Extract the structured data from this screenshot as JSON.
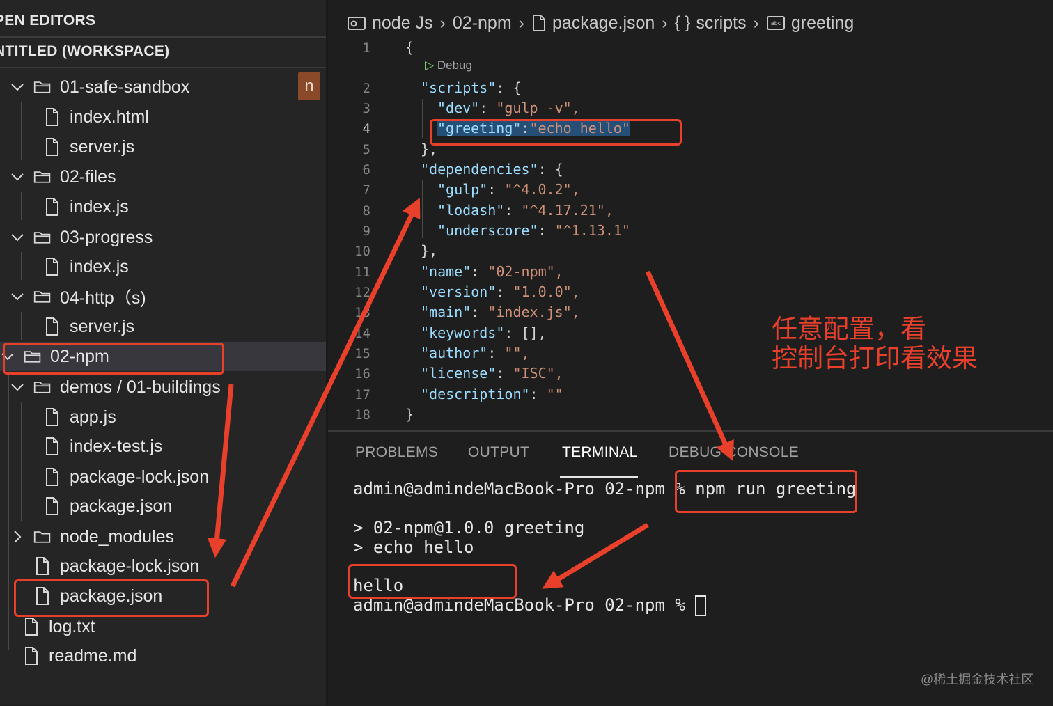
{
  "sidebar": {
    "open_editors": "PEN EDITORS",
    "workspace": "NTITLED (WORKSPACE)",
    "badge": "n",
    "items": [
      {
        "label": "01-safe-sandbox",
        "type": "folder-open"
      },
      {
        "label": "index.html",
        "type": "file"
      },
      {
        "label": "server.js",
        "type": "file"
      },
      {
        "label": "02-files",
        "type": "folder-open"
      },
      {
        "label": "index.js",
        "type": "file"
      },
      {
        "label": "03-progress",
        "type": "folder-open"
      },
      {
        "label": "index.js",
        "type": "file"
      },
      {
        "label": "04-http（s)",
        "type": "folder-open"
      },
      {
        "label": "server.js",
        "type": "file"
      },
      {
        "label": "02-npm",
        "type": "folder-open"
      },
      {
        "label": "demos / 01-buildings",
        "type": "folder-open"
      },
      {
        "label": "app.js",
        "type": "file"
      },
      {
        "label": "index-test.js",
        "type": "file"
      },
      {
        "label": "package-lock.json",
        "type": "file"
      },
      {
        "label": "package.json",
        "type": "file"
      },
      {
        "label": "node_modules",
        "type": "folder-closed"
      },
      {
        "label": "package-lock.json",
        "type": "file"
      },
      {
        "label": "package.json",
        "type": "file"
      },
      {
        "label": "log.txt",
        "type": "file"
      },
      {
        "label": "readme.md",
        "type": "file"
      }
    ]
  },
  "breadcrumb": {
    "items": [
      "node Js",
      "02-npm",
      "package.json",
      "scripts",
      "greeting"
    ]
  },
  "editor": {
    "codelens": "Debug",
    "line_numbers": [
      "1",
      "2",
      "3",
      "4",
      "5",
      "6",
      "7",
      "8",
      "9",
      "10",
      "11",
      "12",
      "13",
      "14",
      "15",
      "16",
      "17",
      "18"
    ],
    "lines": [
      {
        "key": "",
        "value": "{"
      },
      {
        "key": "\"scripts\"",
        "value": ": {"
      },
      {
        "key": "\"dev\"",
        "value": "\"gulp -v\","
      },
      {
        "key": "\"greeting\"",
        "value": "\"echo hello\""
      },
      {
        "key": "",
        "value": "},"
      },
      {
        "key": "\"dependencies\"",
        "value": ": {"
      },
      {
        "key": "\"gulp\"",
        "value": "\"^4.0.2\","
      },
      {
        "key": "\"lodash\"",
        "value": "\"^4.17.21\","
      },
      {
        "key": "\"underscore\"",
        "value": "\"^1.13.1\""
      },
      {
        "key": "",
        "value": "},"
      },
      {
        "key": "\"name\"",
        "value": "\"02-npm\","
      },
      {
        "key": "\"version\"",
        "value": "\"1.0.0\","
      },
      {
        "key": "\"main\"",
        "value": "\"index.js\","
      },
      {
        "key": "\"keywords\"",
        "value": "[],"
      },
      {
        "key": "\"author\"",
        "value": "\"\","
      },
      {
        "key": "\"license\"",
        "value": "\"ISC\","
      },
      {
        "key": "\"description\"",
        "value": "\"\""
      },
      {
        "key": "",
        "value": "}"
      }
    ]
  },
  "panel": {
    "tabs": [
      "PROBLEMS",
      "OUTPUT",
      "TERMINAL",
      "DEBUG CONSOLE"
    ],
    "active_tab": "TERMINAL",
    "prompt": "admin@admindeMacBook-Pro 02-npm % ",
    "command": "npm run greeting",
    "out1": "> 02-npm@1.0.0 greeting",
    "out2": "> echo hello",
    "result": "hello",
    "prompt2": "admin@admindeMacBook-Pro 02-npm % "
  },
  "annotation": {
    "line1": "任意配置，看",
    "line2": "控制台打印看效果",
    "color": "#e8402a"
  },
  "watermark": "@稀土掘金技术社区"
}
